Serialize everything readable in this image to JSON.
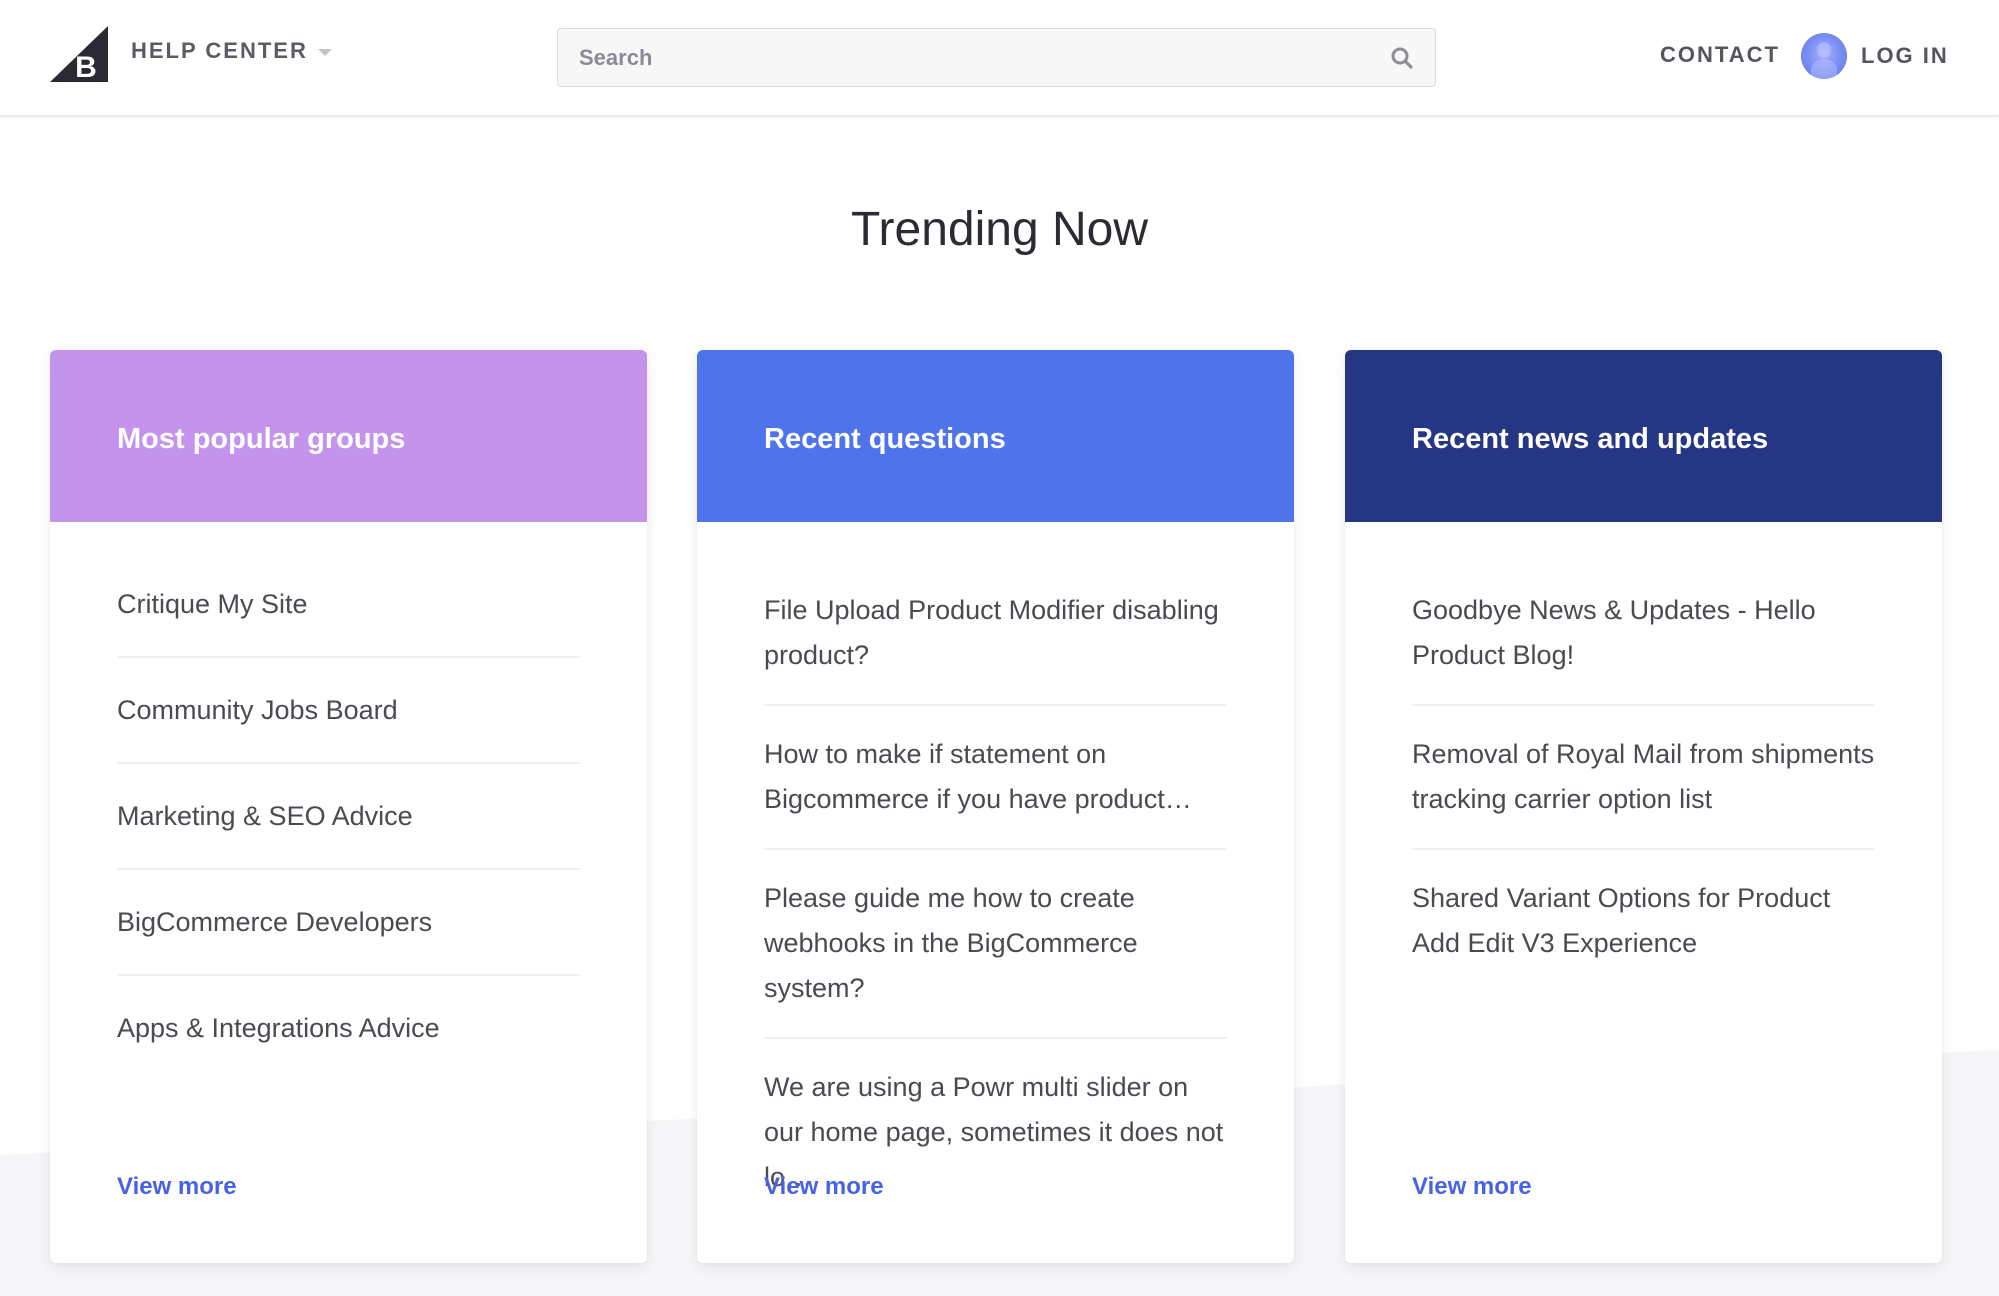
{
  "header": {
    "logo_alt": "BigCommerce",
    "brand_label": "HELP CENTER",
    "search_placeholder": "Search",
    "search_value": "",
    "contact_label": "CONTACT",
    "login_label": "LOG IN",
    "icons": {
      "logo": "bigcommerce-logo-icon",
      "caret": "chevron-down-icon",
      "search": "search-icon",
      "avatar": "user-avatar-icon"
    }
  },
  "main": {
    "title": "Trending Now",
    "cards": [
      {
        "title": "Most popular groups",
        "color": "#c493ec",
        "items": [
          "Critique My Site",
          "Community Jobs Board",
          "Marketing & SEO Advice",
          "BigCommerce Developers",
          "Apps & Integrations Advice"
        ],
        "view_more": "View more"
      },
      {
        "title": "Recent questions",
        "color": "#4f73ea",
        "items": [
          "File Upload Product Modifier disabling product?",
          "How to make if statement on Bigcommerce if you have product…",
          "Please guide me how to create webhooks in the BigCommerce system?",
          "We are using a Powr multi slider on our home page, sometimes it does not lo…"
        ],
        "view_more": "View more"
      },
      {
        "title": "Recent news and updates",
        "color": "#253784",
        "items": [
          "Goodbye News & Updates - Hello Product Blog!",
          "Removal of Royal Mail from shipments tracking carrier option list",
          "Shared Variant Options for Product Add Edit V3 Experience"
        ],
        "view_more": "View more"
      }
    ]
  },
  "colors": {
    "link": "#4763e2",
    "text": "#4a4a52",
    "background_band": "#f6f6f8"
  }
}
